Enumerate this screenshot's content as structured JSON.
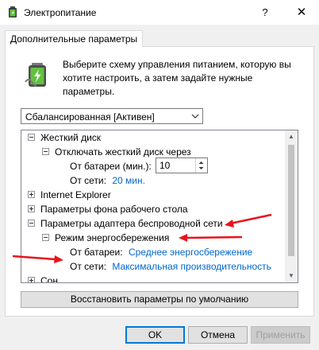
{
  "window": {
    "title": "Электропитание",
    "help_label": "?",
    "close_label": "✕",
    "icon": "battery-icon"
  },
  "tabs": [
    {
      "label": "Дополнительные параметры",
      "active": true
    }
  ],
  "description": "Выберите схему управления питанием, которую вы хотите настроить, а затем задайте нужные параметры.",
  "scheme": {
    "selected": "Сбалансированная [Активен]"
  },
  "tree": {
    "items": [
      {
        "label": "Жесткий диск",
        "state": "expanded",
        "level": 0
      },
      {
        "label": "Отключать жесткий диск через",
        "state": "expanded",
        "level": 1
      },
      {
        "label": "От батареи (мин.):",
        "level": 2,
        "spin_value": "10"
      },
      {
        "label": "От сети:",
        "level": 2,
        "value": "20 мин."
      },
      {
        "label": "Internet Explorer",
        "state": "collapsed",
        "level": 0
      },
      {
        "label": "Параметры фона рабочего стола",
        "state": "collapsed",
        "level": 0
      },
      {
        "label": "Параметры адаптера беспроводной сети",
        "state": "expanded",
        "level": 0
      },
      {
        "label": "Режим энергосбережения",
        "state": "expanded",
        "level": 1
      },
      {
        "label": "От батареи:",
        "level": 2,
        "value": "Среднее энергосбережение"
      },
      {
        "label": "От сети:",
        "level": 2,
        "value": "Максимальная производительность"
      },
      {
        "label": "Сон",
        "state": "collapsed",
        "level": 0
      }
    ]
  },
  "restore_button": "Восстановить параметры по умолчанию",
  "buttons": {
    "ok": "OK",
    "cancel": "Отмена",
    "apply": "Применить"
  },
  "colors": {
    "link": "#0066cc",
    "annotation": "#e8141c",
    "accent": "#0078d7"
  }
}
